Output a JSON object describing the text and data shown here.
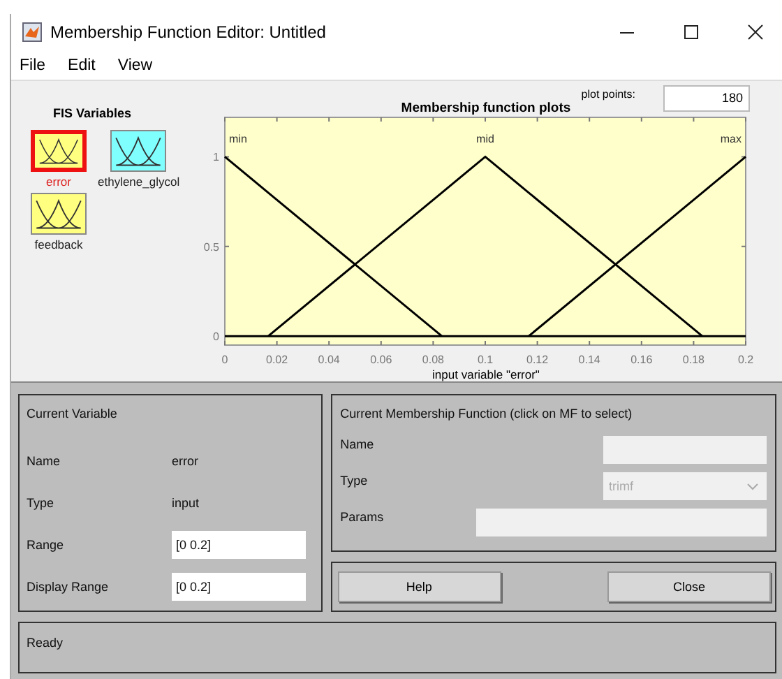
{
  "window": {
    "title": "Membership Function Editor: Untitled"
  },
  "menu": [
    "File",
    "Edit",
    "View"
  ],
  "fis_variables": {
    "title": "FIS Variables",
    "items": [
      {
        "label": "error",
        "color": "#ffff80",
        "selected": true
      },
      {
        "label": "ethylene_glycol",
        "color": "#80ffff",
        "selected": false
      },
      {
        "label": "feedback",
        "color": "#ffff80",
        "selected": false
      }
    ]
  },
  "plot_points": {
    "label": "plot points:",
    "value": "180"
  },
  "chart_data": {
    "type": "line",
    "title": "Membership function plots",
    "xlabel": "input variable \"error\"",
    "x": [
      0,
      0.0167,
      0.0833,
      0.1,
      0.1167,
      0.1833,
      0.2
    ],
    "series": [
      {
        "name": "min",
        "color": "#000000",
        "values": [
          1,
          0.8,
          0,
          null,
          null,
          null,
          null
        ]
      },
      {
        "name": "mid",
        "color": "#000000",
        "values": [
          null,
          0,
          0.8,
          1,
          0.8,
          0,
          null
        ]
      },
      {
        "name": "max",
        "color": "#000000",
        "values": [
          null,
          null,
          null,
          null,
          0,
          0.8,
          1
        ]
      }
    ],
    "xlim": [
      0,
      0.2
    ],
    "ylim": [
      -0.05,
      1.22
    ],
    "xticks": [
      0,
      0.02,
      0.04,
      0.06,
      0.08,
      0.1,
      0.12,
      0.14,
      0.16,
      0.18,
      0.2
    ],
    "yticks": [
      0,
      0.5,
      1
    ]
  },
  "current_variable": {
    "title": "Current Variable",
    "rows": [
      {
        "label": "Name",
        "kind": "text",
        "value": "error"
      },
      {
        "label": "Type",
        "kind": "text",
        "value": "input"
      },
      {
        "label": "Range",
        "kind": "field",
        "value": "[0 0.2]"
      },
      {
        "label": "Display Range",
        "kind": "field",
        "value": "[0 0.2]"
      }
    ]
  },
  "current_mf": {
    "title": "Current Membership Function (click on MF to select)",
    "rows": [
      {
        "label": "Name",
        "kind": "field"
      },
      {
        "label": "Type",
        "kind": "dropdown",
        "value": "trimf"
      },
      {
        "label": "Params",
        "kind": "wide_field"
      }
    ]
  },
  "buttons": [
    "Help",
    "Close"
  ],
  "status": "Ready"
}
